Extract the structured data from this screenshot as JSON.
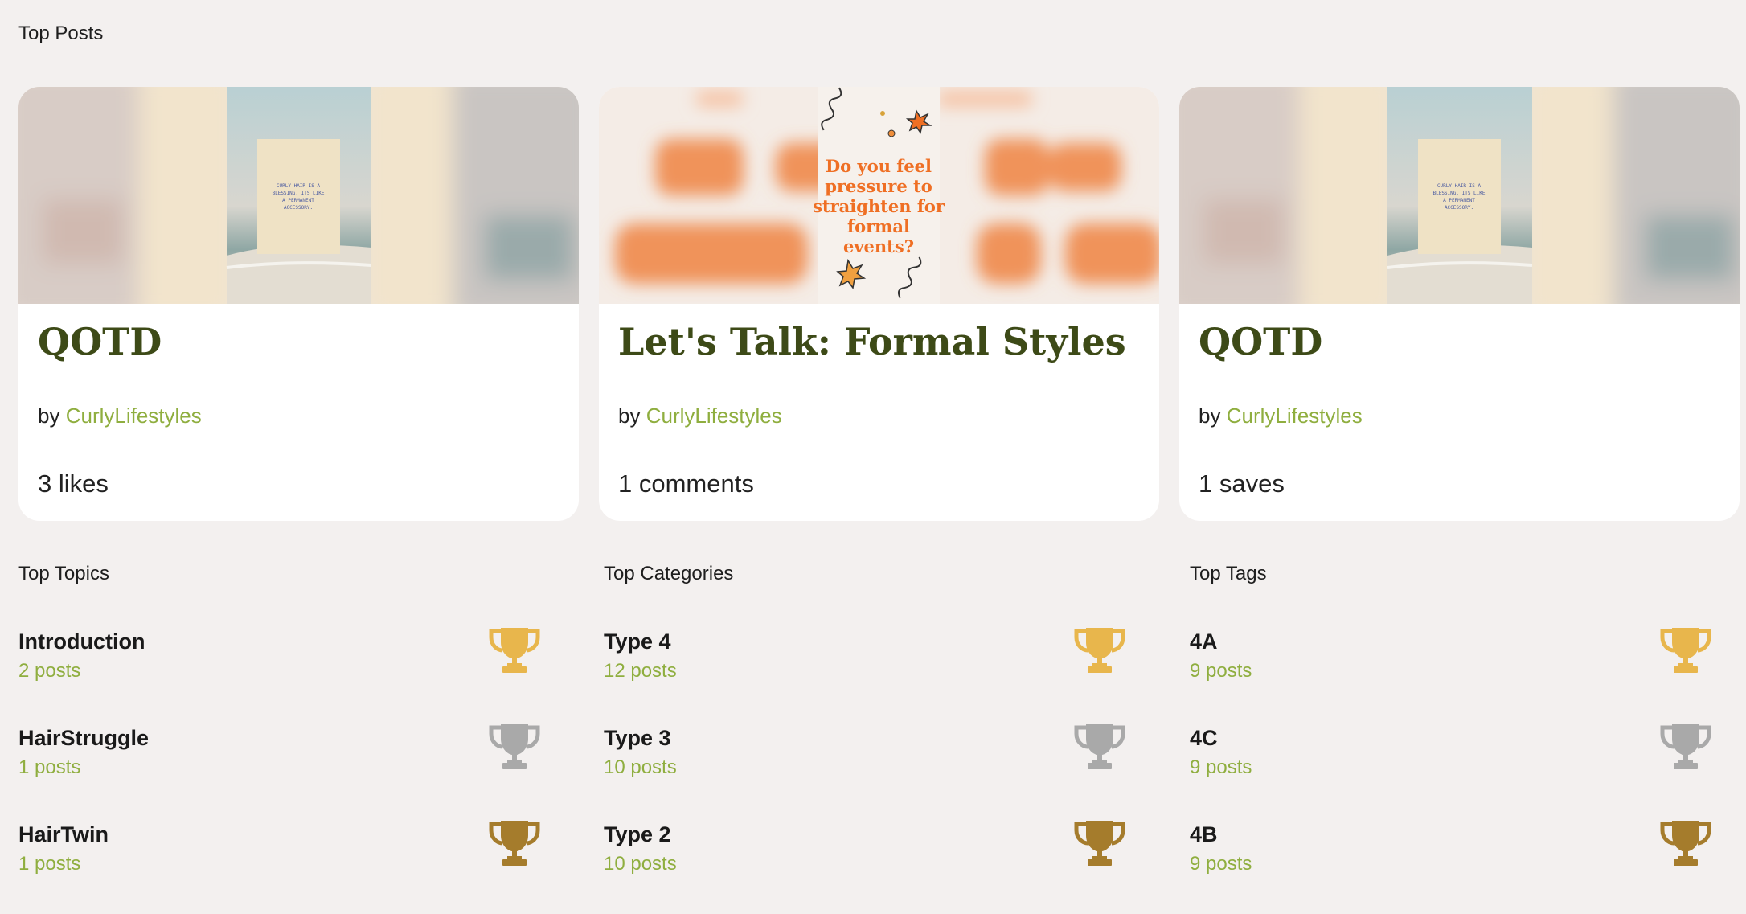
{
  "sections": {
    "top_posts": "Top Posts",
    "top_topics": "Top Topics",
    "top_categories": "Top Categories",
    "top_tags": "Top Tags"
  },
  "posts": [
    {
      "title": "QOTD",
      "by": "by",
      "author": "CurlyLifestyles",
      "metric": "3 likes",
      "image_text": "CURLY HAIR IS A BLESSING, ITS LIKE A PERMANENT ACCESSORY."
    },
    {
      "title": "Let's Talk: Formal Styles",
      "by": "by",
      "author": "CurlyLifestyles",
      "metric": "1 comments",
      "image_text_lines": [
        "Do you feel",
        "pressure to",
        "straighten for",
        "formal",
        "events?"
      ]
    },
    {
      "title": "QOTD",
      "by": "by",
      "author": "CurlyLifestyles",
      "metric": "1 saves",
      "image_text": "CURLY HAIR IS A BLESSING, ITS LIKE A PERMANENT ACCESSORY."
    }
  ],
  "topics": [
    {
      "name": "Introduction",
      "count": "2 posts",
      "medal": "gold"
    },
    {
      "name": "HairStruggle",
      "count": "1 posts",
      "medal": "silver"
    },
    {
      "name": "HairTwin",
      "count": "1 posts",
      "medal": "bronze"
    }
  ],
  "categories": [
    {
      "name": "Type 4",
      "count": "12 posts",
      "medal": "gold"
    },
    {
      "name": "Type 3",
      "count": "10 posts",
      "medal": "silver"
    },
    {
      "name": "Type 2",
      "count": "10 posts",
      "medal": "bronze"
    }
  ],
  "tags": [
    {
      "name": "4A",
      "count": "9 posts",
      "medal": "gold"
    },
    {
      "name": "4C",
      "count": "9 posts",
      "medal": "silver"
    },
    {
      "name": "4B",
      "count": "9 posts",
      "medal": "bronze"
    }
  ],
  "colors": {
    "background": "#f3f0ef",
    "title_green": "#3d4a17",
    "accent_green": "#8fae3f",
    "gold": "#e8b64c",
    "silver": "#a9a9a9",
    "bronze": "#a57c2c",
    "orange_text": "#ef6f24"
  },
  "icons": {
    "trophy": "trophy-icon"
  }
}
